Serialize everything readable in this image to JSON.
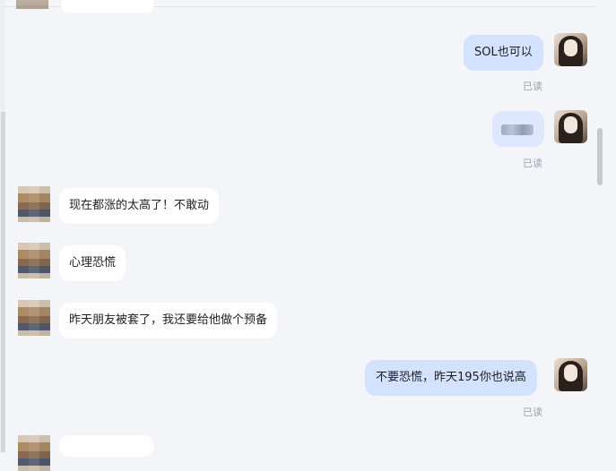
{
  "messages": {
    "m1": {
      "side": "out",
      "text": "SOL也可以",
      "status": "已读"
    },
    "m2": {
      "side": "out",
      "text": "",
      "status": "已读"
    },
    "m3": {
      "side": "in",
      "text": "现在都涨的太高了！不敢动"
    },
    "m4": {
      "side": "in",
      "text": "心理恐慌"
    },
    "m5": {
      "side": "in",
      "text": "昨天朋友被套了，我还要给他做个预备"
    },
    "m6": {
      "side": "out",
      "text": "不要恐慌，昨天195你也说高",
      "status": "已读"
    }
  },
  "colors": {
    "outgoing_bubble": "#d3e2ff",
    "incoming_bubble": "#ffffff",
    "background": "#f4f5f9",
    "read_status": "#9aa0a6"
  }
}
